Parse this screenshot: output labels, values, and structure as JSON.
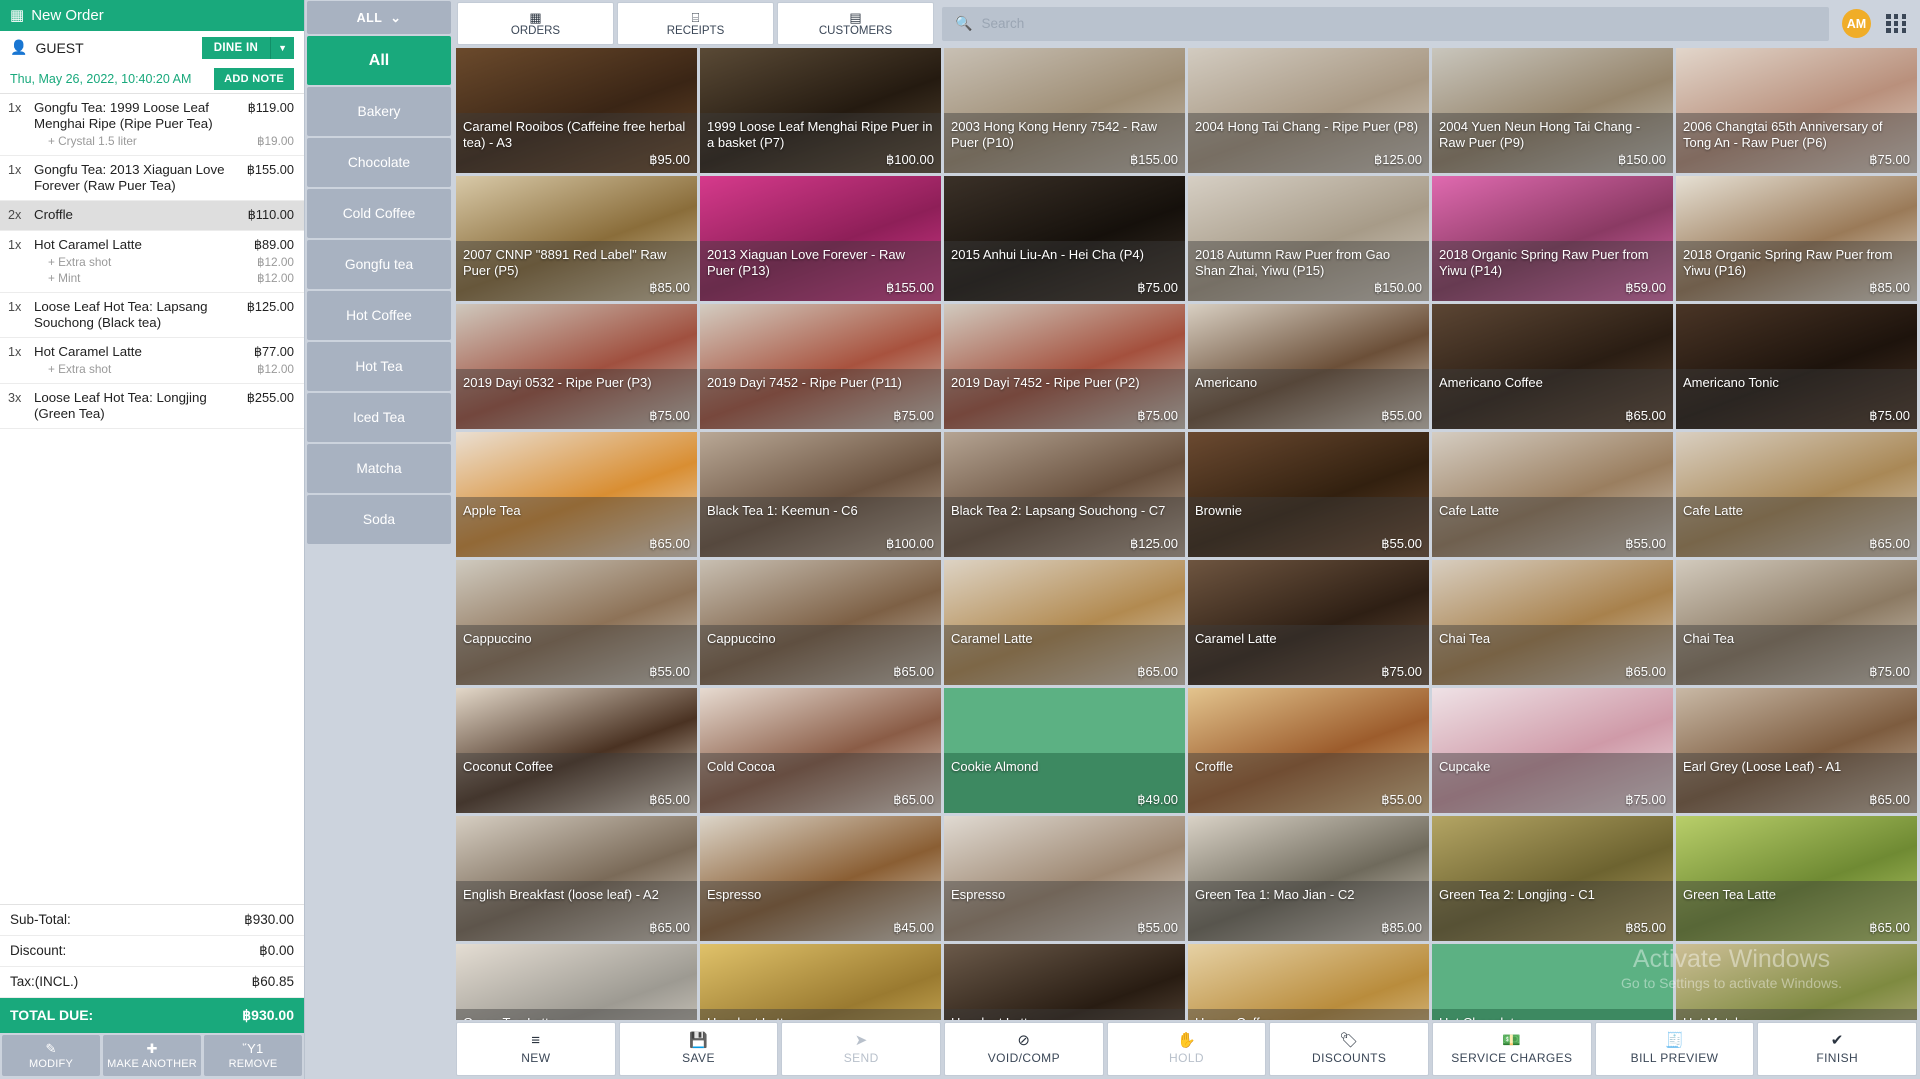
{
  "order": {
    "title": "New Order",
    "title_icon": "receipt-icon",
    "guest_label": "GUEST",
    "guest_icon": "contact-card-icon",
    "dine_in_label": "DINE IN",
    "dine_in_caret": "▼",
    "datetime": "Thu, May 26, 2022, 10:40:20 AM",
    "add_note_label": "ADD NOTE",
    "items": [
      {
        "qty": "1x",
        "name": "Gongfu Tea: 1999 Loose Leaf Menghai Ripe (Ripe Puer Tea)",
        "price": "฿119.00",
        "selected": false,
        "modifiers": [
          {
            "name": "+ Crystal 1.5 liter",
            "price": "฿19.00"
          }
        ]
      },
      {
        "qty": "1x",
        "name": "Gongfu Tea: 2013 Xiaguan Love Forever (Raw Puer Tea)",
        "price": "฿155.00",
        "selected": false,
        "modifiers": []
      },
      {
        "qty": "2x",
        "name": "Croffle",
        "price": "฿110.00",
        "selected": true,
        "modifiers": []
      },
      {
        "qty": "1x",
        "name": "Hot Caramel Latte",
        "price": "฿89.00",
        "selected": false,
        "modifiers": [
          {
            "name": "+ Extra shot",
            "price": "฿12.00"
          },
          {
            "name": "+ Mint",
            "price": "฿12.00"
          }
        ]
      },
      {
        "qty": "1x",
        "name": "Loose Leaf Hot Tea: Lapsang Souchong (Black tea)",
        "price": "฿125.00",
        "selected": false,
        "modifiers": []
      },
      {
        "qty": "1x",
        "name": "Hot Caramel Latte",
        "price": "฿77.00",
        "selected": false,
        "modifiers": [
          {
            "name": "+ Extra shot",
            "price": "฿12.00"
          }
        ]
      },
      {
        "qty": "3x",
        "name": "Loose Leaf Hot Tea: Longjing (Green Tea)",
        "price": "฿255.00",
        "selected": false,
        "modifiers": []
      }
    ],
    "totals": [
      {
        "label": "Sub-Total:",
        "value": "฿930.00"
      },
      {
        "label": "Discount:",
        "value": "฿0.00"
      },
      {
        "label": "Tax:(INCL.)",
        "value": "฿60.85"
      }
    ],
    "total_due_label": "TOTAL DUE:",
    "total_due_value": "฿930.00",
    "actions": [
      {
        "label": "MODIFY",
        "icon": "✎",
        "icon_name": "pencil-icon"
      },
      {
        "label": "MAKE ANOTHER",
        "icon": "✚",
        "icon_name": "plus-square-icon"
      },
      {
        "label": "REMOVE",
        "icon": "Ὕ1",
        "icon_name": "trash-icon"
      }
    ]
  },
  "categories": {
    "all_button_label": "ALL",
    "all_button_caret": "⌄",
    "items": [
      {
        "label": "All",
        "active": true
      },
      {
        "label": "Bakery",
        "active": false
      },
      {
        "label": "Chocolate",
        "active": false
      },
      {
        "label": "Cold Coffee",
        "active": false
      },
      {
        "label": "Gongfu tea",
        "active": false
      },
      {
        "label": "Hot Coffee",
        "active": false
      },
      {
        "label": "Hot Tea",
        "active": false
      },
      {
        "label": "Iced Tea",
        "active": false
      },
      {
        "label": "Matcha",
        "active": false
      },
      {
        "label": "Soda",
        "active": false
      }
    ]
  },
  "topbar": {
    "tabs": [
      {
        "label": "ORDERS",
        "icon": "▦",
        "icon_name": "orders-grid-icon"
      },
      {
        "label": "RECEIPTS",
        "icon": "⌸",
        "icon_name": "receipt-icon"
      },
      {
        "label": "CUSTOMERS",
        "icon": "▤",
        "icon_name": "contact-card-icon"
      }
    ],
    "search_placeholder": "Search",
    "search_value": "",
    "search_icon": "magnifier-icon",
    "avatar_initials": "AM",
    "apps_icon": "apps-grid-icon"
  },
  "products": [
    {
      "name": "Caramel Rooibos (Caffeine free herbal tea) - A3",
      "price": "฿95.00",
      "c1": "#6b4a2c",
      "c2": "#3a2515",
      "solid": false
    },
    {
      "name": "1999 Loose Leaf Menghai Ripe Puer in a basket (P7)",
      "price": "฿100.00",
      "c1": "#5a4a36",
      "c2": "#241a10",
      "solid": false
    },
    {
      "name": "2003 Hong Kong Henry 7542 - Raw Puer (P10)",
      "price": "฿155.00",
      "c1": "#c8c0b4",
      "c2": "#9e8d74",
      "solid": false
    },
    {
      "name": "2004 Hong Tai Chang - Ripe Puer (P8)",
      "price": "฿125.00",
      "c1": "#d2cbc0",
      "c2": "#a89883",
      "solid": false
    },
    {
      "name": "2004 Yuen Neun Hong Tai Chang - Raw Puer (P9)",
      "price": "฿150.00",
      "c1": "#c9c6bd",
      "c2": "#96856c",
      "solid": false
    },
    {
      "name": "2006 Changtai 65th Anniversary of Tong An - Raw Puer (P6)",
      "price": "฿75.00",
      "c1": "#e2d6cb",
      "c2": "#b9907c",
      "solid": false
    },
    {
      "name": "2007 CNNP \"8891 Red Label\" Raw Puer (P5)",
      "price": "฿85.00",
      "c1": "#d8c9a8",
      "c2": "#8a6d3a",
      "solid": false
    },
    {
      "name": "2013 Xiaguan Love Forever - Raw Puer (P13)",
      "price": "฿155.00",
      "c1": "#d63a8c",
      "c2": "#8e1f58",
      "solid": false
    },
    {
      "name": "2015 Anhui Liu-An - Hei Cha (P4)",
      "price": "฿75.00",
      "c1": "#3b3128",
      "c2": "#15100b",
      "solid": false
    },
    {
      "name": "2018 Autumn Raw Puer from Gao Shan Zhai, Yiwu (P15)",
      "price": "฿150.00",
      "c1": "#d6cfc4",
      "c2": "#a79b88",
      "solid": false
    },
    {
      "name": "2018 Organic Spring Raw Puer from Yiwu (P14)",
      "price": "฿59.00",
      "c1": "#e06ab0",
      "c2": "#8a3a63",
      "solid": false
    },
    {
      "name": "2018 Organic Spring Raw Puer from Yiwu (P16)",
      "price": "฿85.00",
      "c1": "#e6e0d4",
      "c2": "#9a7a58",
      "solid": false
    },
    {
      "name": "2019 Dayi 0532 - Ripe Puer (P3)",
      "price": "฿75.00",
      "c1": "#cfc8bd",
      "c2": "#a0503f",
      "solid": false
    },
    {
      "name": "2019 Dayi 7452 - Ripe Puer (P11)",
      "price": "฿75.00",
      "c1": "#d3ccc1",
      "c2": "#a8523e",
      "solid": false
    },
    {
      "name": "2019 Dayi 7452 - Ripe Puer (P2)",
      "price": "฿75.00",
      "c1": "#d1cabf",
      "c2": "#a4503d",
      "solid": false
    },
    {
      "name": "Americano",
      "price": "฿55.00",
      "c1": "#d8cfc2",
      "c2": "#6b4f38",
      "solid": false
    },
    {
      "name": "Americano Coffee",
      "price": "฿65.00",
      "c1": "#5c4634",
      "c2": "#2a1d13",
      "solid": false
    },
    {
      "name": "Americano Tonic",
      "price": "฿75.00",
      "c1": "#4a3526",
      "c2": "#1d130c",
      "solid": false
    },
    {
      "name": "Apple Tea",
      "price": "฿65.00",
      "c1": "#eadfd2",
      "c2": "#d98e32",
      "solid": false
    },
    {
      "name": "Black Tea 1: Keemun - C6",
      "price": "฿100.00",
      "c1": "#b9a896",
      "c2": "#6b5340",
      "solid": false
    },
    {
      "name": "Black Tea 2: Lapsang Souchong - C7",
      "price": "฿125.00",
      "c1": "#b5a493",
      "c2": "#68503d",
      "solid": false
    },
    {
      "name": "Brownie",
      "price": "฿55.00",
      "c1": "#6b4a31",
      "c2": "#32200f",
      "solid": false
    },
    {
      "name": "Cafe Latte",
      "price": "฿55.00",
      "c1": "#d5cdc2",
      "c2": "#9a7e5f",
      "solid": false
    },
    {
      "name": "Cafe Latte",
      "price": "฿65.00",
      "c1": "#d9cfc1",
      "c2": "#a98856",
      "solid": false
    },
    {
      "name": "Cappuccino",
      "price": "฿55.00",
      "c1": "#cfcabf",
      "c2": "#8d7257",
      "solid": false
    },
    {
      "name": "Cappuccino",
      "price": "฿65.00",
      "c1": "#c8bfb2",
      "c2": "#7d6045",
      "solid": false
    },
    {
      "name": "Caramel Latte",
      "price": "฿65.00",
      "c1": "#ddd3c4",
      "c2": "#b28a50",
      "solid": false
    },
    {
      "name": "Caramel Latte",
      "price": "฿75.00",
      "c1": "#6e5540",
      "c2": "#2e1f14",
      "solid": false
    },
    {
      "name": "Chai Tea",
      "price": "฿65.00",
      "c1": "#d8cec0",
      "c2": "#a8814c",
      "solid": false
    },
    {
      "name": "Chai Tea",
      "price": "฿75.00",
      "c1": "#d2cabd",
      "c2": "#8c7a63",
      "solid": false
    },
    {
      "name": "Coconut Coffee",
      "price": "฿65.00",
      "c1": "#e3d8c9",
      "c2": "#4a3222",
      "solid": false
    },
    {
      "name": "Cold Cocoa",
      "price": "฿65.00",
      "c1": "#e7dbd1",
      "c2": "#8a5c46",
      "solid": false
    },
    {
      "name": "Cookie Almond",
      "price": "฿49.00",
      "c1": "#5cb183",
      "c2": "#5cb183",
      "solid": true
    },
    {
      "name": "Croffle",
      "price": "฿55.00",
      "c1": "#e3c48e",
      "c2": "#9c5c2c",
      "solid": false
    },
    {
      "name": "Cupcake",
      "price": "฿75.00",
      "c1": "#efe2e6",
      "c2": "#cf9aa8",
      "solid": false
    },
    {
      "name": "Earl Grey (Loose Leaf) - A1",
      "price": "฿65.00",
      "c1": "#c9b9a6",
      "c2": "#7d5c3f",
      "solid": false
    },
    {
      "name": "English Breakfast (loose leaf) - A2",
      "price": "฿65.00",
      "c1": "#d6cec2",
      "c2": "#7a6a58",
      "solid": false
    },
    {
      "name": "Espresso",
      "price": "฿45.00",
      "c1": "#dcd5c9",
      "c2": "#8a5e33",
      "solid": false
    },
    {
      "name": "Espresso",
      "price": "฿55.00",
      "c1": "#e0dad2",
      "c2": "#9d8771",
      "solid": false
    },
    {
      "name": "Green Tea 1: Mao Jian - C2",
      "price": "฿85.00",
      "c1": "#d9d2c6",
      "c2": "#6f6a5c",
      "solid": false
    },
    {
      "name": "Green Tea 2: Longjing - C1",
      "price": "฿85.00",
      "c1": "#b4a564",
      "c2": "#6d6330",
      "solid": false
    },
    {
      "name": "Green Tea Latte",
      "price": "฿65.00",
      "c1": "#b9cf6a",
      "c2": "#6f8a33",
      "solid": false
    },
    {
      "name": "Green Tea Latte",
      "price": "",
      "c1": "#e4ddd3",
      "c2": "#9d9a92",
      "solid": false
    },
    {
      "name": "Hazelnut Latte",
      "price": "",
      "c1": "#e0c26a",
      "c2": "#9a7a30",
      "solid": false
    },
    {
      "name": "Hazelnut Latte",
      "price": "",
      "c1": "#6b5a4a",
      "c2": "#281c12",
      "solid": false
    },
    {
      "name": "Honey Coffee",
      "price": "",
      "c1": "#e6d1a4",
      "c2": "#b98c3c",
      "solid": false
    },
    {
      "name": "Hot Chocolate",
      "price": "",
      "c1": "#5cb183",
      "c2": "#5cb183",
      "solid": true
    },
    {
      "name": "Hot Matcha",
      "price": "",
      "c1": "#cdbf96",
      "c2": "#7e8a40",
      "solid": false
    }
  ],
  "bottombar": [
    {
      "label": "NEW",
      "icon": "≡",
      "icon_name": "new-lines-icon",
      "disabled": false
    },
    {
      "label": "SAVE",
      "icon": "💾",
      "icon_name": "floppy-disk-icon",
      "disabled": false
    },
    {
      "label": "SEND",
      "icon": "➤",
      "icon_name": "send-arrow-icon",
      "disabled": true
    },
    {
      "label": "VOID/COMP",
      "icon": "⊘",
      "icon_name": "void-circle-slash-icon",
      "disabled": false
    },
    {
      "label": "HOLD",
      "icon": "✋",
      "icon_name": "hand-hold-icon",
      "disabled": true
    },
    {
      "label": "DISCOUNTS",
      "icon": "🏷",
      "icon_name": "price-tag-icon",
      "disabled": false
    },
    {
      "label": "SERVICE CHARGES",
      "icon": "💵",
      "icon_name": "money-bill-icon",
      "disabled": false
    },
    {
      "label": "BILL PREVIEW",
      "icon": "🧾",
      "icon_name": "bill-receipt-icon",
      "disabled": false
    },
    {
      "label": "FINISH",
      "icon": "✔",
      "icon_name": "check-circle-icon",
      "disabled": false
    }
  ],
  "watermark": {
    "line1": "Activate Windows",
    "line2": "Go to Settings to activate Windows."
  }
}
